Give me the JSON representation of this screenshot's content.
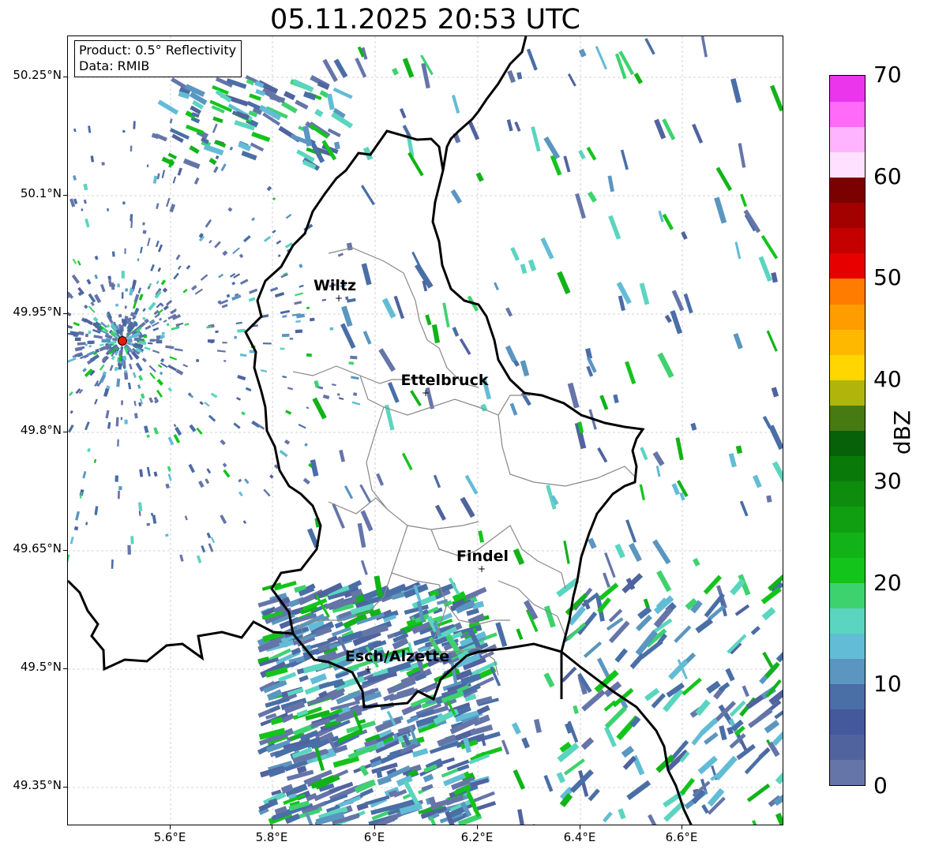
{
  "title": "05.11.2025 20:53 UTC",
  "info_box": {
    "product": "Product: 0.5° Reflectivity",
    "source": "Data: RMIB"
  },
  "axes": {
    "lat_labels": [
      "50.25°N",
      "50.1°N",
      "49.95°N",
      "49.8°N",
      "49.65°N",
      "49.5°N",
      "49.35°N"
    ],
    "lon_labels": [
      "5.6°E",
      "5.8°E",
      "6°E",
      "6.2°E",
      "6.4°E",
      "6.6°E"
    ]
  },
  "cities": [
    {
      "name": "Wiltz",
      "lon": 5.93,
      "lat": 49.97
    },
    {
      "name": "Ettelbruck",
      "lon": 6.1,
      "lat": 49.85
    },
    {
      "name": "Findel",
      "lon": 6.21,
      "lat": 49.63
    },
    {
      "name": "Esch/Alzette",
      "lon": 5.99,
      "lat": 49.5
    }
  ],
  "radar_site": {
    "lon": 5.505,
    "lat": 49.914,
    "color": "#e8180c"
  },
  "colorbar": {
    "unit": "dBZ",
    "tick_labels": [
      "0",
      "10",
      "20",
      "30",
      "40",
      "50",
      "60",
      "70"
    ],
    "colors": [
      "#6675a8",
      "#50639f",
      "#43599c",
      "#4a6ea6",
      "#5a96c0",
      "#63bcd6",
      "#5bd5bf",
      "#3ed26f",
      "#13c41b",
      "#11b318",
      "#119f12",
      "#0e8c0e",
      "#097a0a",
      "#066108",
      "#477a12",
      "#b1b40a",
      "#ffd600",
      "#ffb800",
      "#ff9c00",
      "#ff7c00",
      "#e60000",
      "#c40000",
      "#a30000",
      "#7b0000",
      "#ffe1ff",
      "#ffb4ff",
      "#ff6af9",
      "#ea35ec"
    ]
  },
  "map_style": {
    "border_color": "#000000",
    "district_color": "#888888",
    "grid_color": "#c8c8c8"
  }
}
